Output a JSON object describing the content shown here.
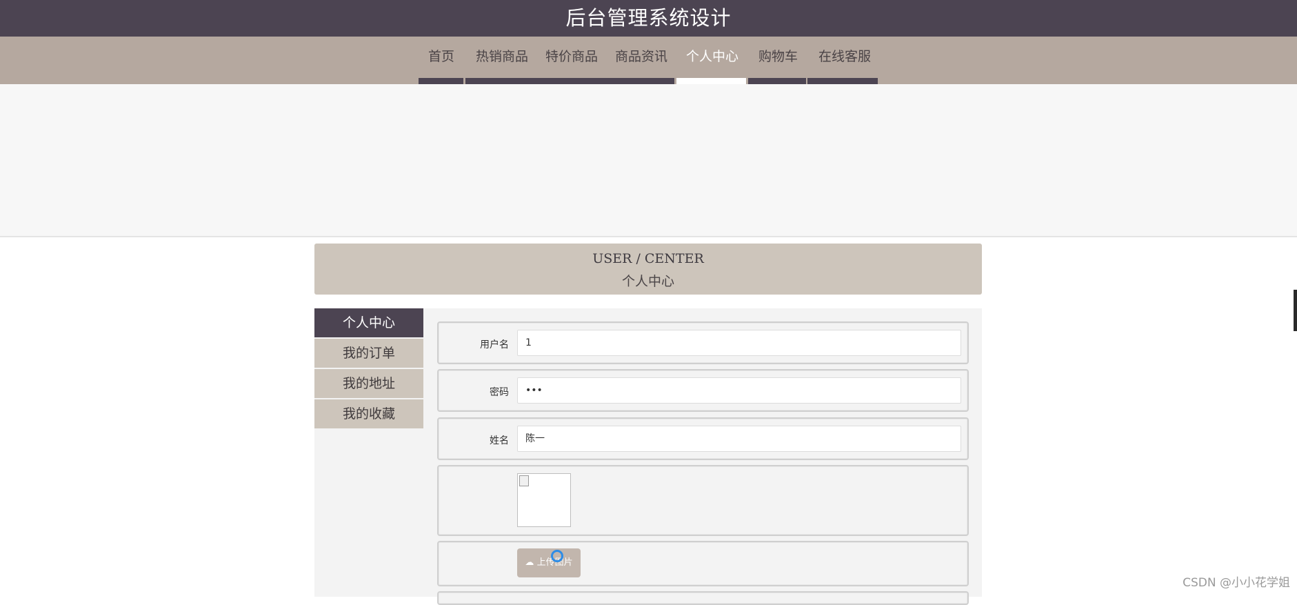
{
  "header": {
    "title": "后台管理系统设计"
  },
  "nav": {
    "items": [
      {
        "label": "首页"
      },
      {
        "label": "热销商品"
      },
      {
        "label": "特价商品"
      },
      {
        "label": "商品资讯"
      },
      {
        "label": "个人中心",
        "active": true
      },
      {
        "label": "购物车"
      },
      {
        "label": "在线客服"
      }
    ]
  },
  "section": {
    "title_en": "USER / CENTER",
    "title_cn": "个人中心"
  },
  "sidebar": {
    "items": [
      {
        "label": "个人中心",
        "active": true
      },
      {
        "label": "我的订单"
      },
      {
        "label": "我的地址"
      },
      {
        "label": "我的收藏"
      }
    ]
  },
  "form": {
    "username": {
      "label": "用户名",
      "value": "1"
    },
    "password": {
      "label": "密码",
      "value": "•••"
    },
    "name": {
      "label": "姓名",
      "value": "陈一"
    },
    "upload_label": "上传图片"
  },
  "watermark": "CSDN @小小花学姐",
  "colors": {
    "topbar": "#4c4452",
    "navbar": "#b5a89f",
    "accent": "#cdc5bb",
    "upload": "#c2b6ad"
  }
}
